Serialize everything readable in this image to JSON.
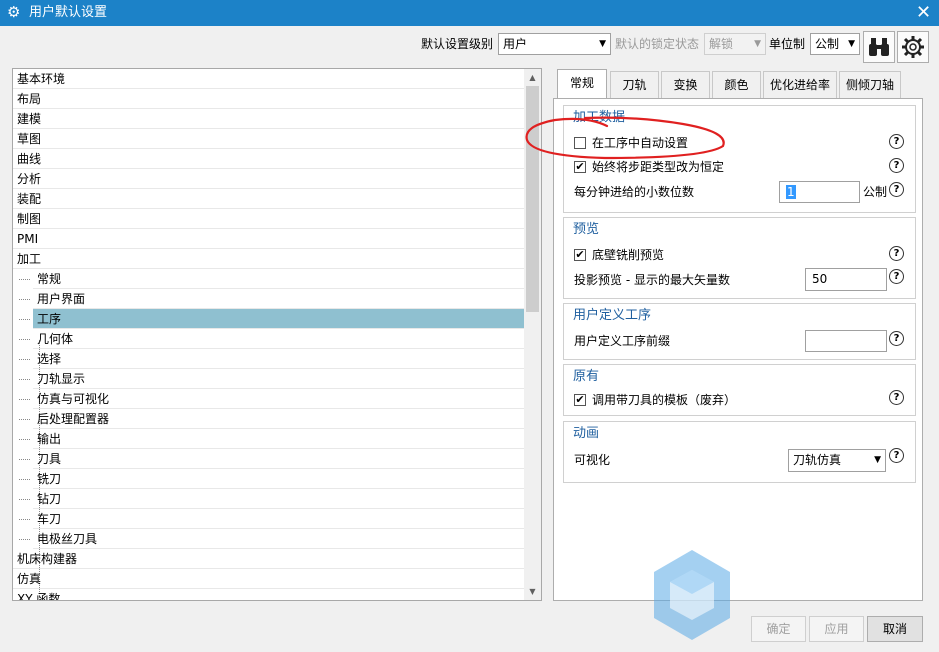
{
  "window": {
    "title": "用户默认设置",
    "close_glyph": "✕"
  },
  "toolbar": {
    "level_label": "默认设置级别",
    "level_value": "用户",
    "lock_label": "默认的锁定状态",
    "lock_value": "解锁",
    "unit_label": "单位制",
    "unit_value": "公制"
  },
  "tree": {
    "items": [
      "基本环境",
      "布局",
      "建模",
      "草图",
      "曲线",
      "分析",
      "装配",
      "制图",
      "PMI",
      "加工",
      "常规",
      "用户界面",
      "工序",
      "几何体",
      "选择",
      "刀轨显示",
      "仿真与可视化",
      "后处理配置器",
      "输出",
      "刀具",
      "铣刀",
      "钻刀",
      "车刀",
      "电极丝刀具",
      "机床构建器",
      "仿真",
      "XY 函数"
    ]
  },
  "tabs": [
    "常规",
    "刀轨",
    "变换",
    "颜色",
    "优化进给率",
    "侧倾刀轴"
  ],
  "groups": {
    "machining": {
      "title": "加工数据",
      "auto_setting": "在工序中自动设置",
      "constant_step": "始终将步距类型改为恒定",
      "decimals_label": "每分钟进给的小数位数",
      "decimals_value": "1",
      "unit": "公制"
    },
    "preview": {
      "title": "预览",
      "floor_wall": "底壁铣削预览",
      "max_vectors_label": "投影预览 - 显示的最大矢量数",
      "max_vectors_value": "50"
    },
    "user_op": {
      "title": "用户定义工序",
      "prefix_label": "用户定义工序前缀",
      "prefix_value": ""
    },
    "legacy": {
      "title": "原有",
      "template": "调用带刀具的模板（废弃）"
    },
    "animation": {
      "title": "动画",
      "visual_label": "可视化",
      "visual_value": "刀轨仿真"
    }
  },
  "buttons": {
    "ok": "确定",
    "apply": "应用",
    "cancel": "取消"
  },
  "colors": {
    "titlebar": "#1c82c8",
    "selected_row": "#8fc0d0",
    "annotation": "#e02020"
  }
}
